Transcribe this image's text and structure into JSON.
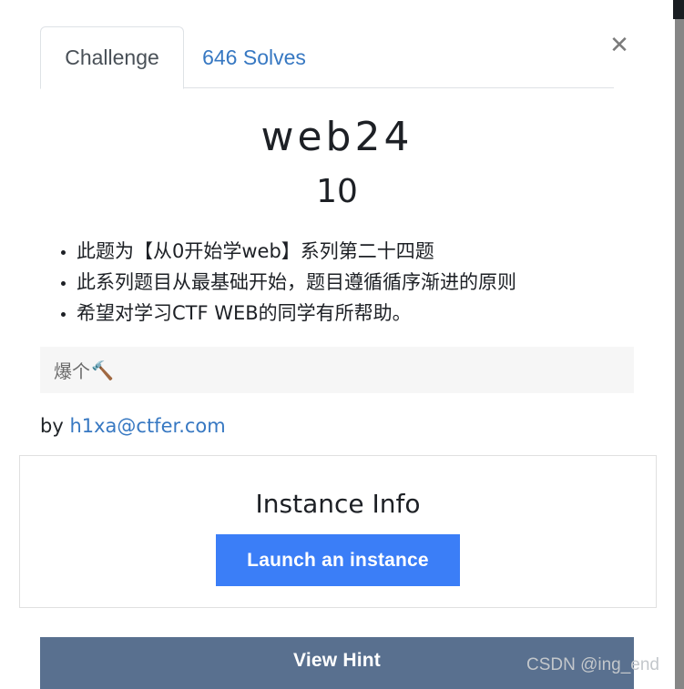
{
  "modal": {
    "tabs": [
      {
        "label": "Challenge",
        "active": true
      },
      {
        "label": "646 Solves",
        "active": false
      }
    ],
    "close_icon": "close-x-icon"
  },
  "challenge": {
    "name": "web24",
    "value": "10",
    "description_items": [
      "此题为【从0开始学web】系列第二十四题",
      "此系列题目从最基础开始，题目遵循循序渐进的原则",
      "希望对学习CTF WEB的同学有所帮助。"
    ],
    "code_text": "爆个",
    "code_emoji": "🔨",
    "author_prefix": "by ",
    "author_link": "h1xa@ctfer.com"
  },
  "instance": {
    "title": "Instance Info",
    "launch_label": "Launch an instance"
  },
  "hint": {
    "label": "View Hint"
  },
  "watermark": {
    "text": "CSDN @ing_end"
  },
  "colors": {
    "link": "#3778c2",
    "primary_button": "#3b7ef7",
    "hint_bar": "#59708f",
    "code_background": "#f6f6f6",
    "border": "#dee2e6",
    "text": "#1d2025",
    "scrollbar_thumb": "#868686"
  }
}
